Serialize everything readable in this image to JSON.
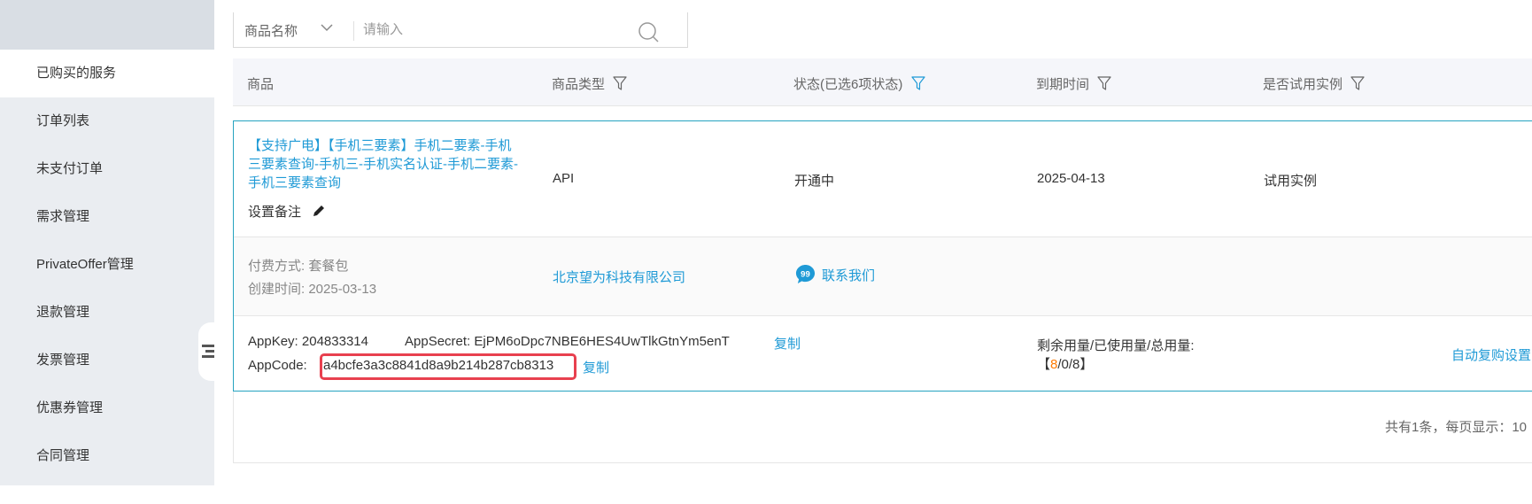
{
  "sidebar": {
    "items": [
      {
        "label": "已购买的服务",
        "active": true
      },
      {
        "label": "订单列表"
      },
      {
        "label": "未支付订单"
      },
      {
        "label": "需求管理"
      },
      {
        "label": "PrivateOffer管理"
      },
      {
        "label": "退款管理"
      },
      {
        "label": "发票管理"
      },
      {
        "label": "优惠券管理"
      },
      {
        "label": "合同管理"
      }
    ]
  },
  "search": {
    "field_selected": "商品名称",
    "placeholder": "请输入"
  },
  "table": {
    "headers": {
      "product": "商品",
      "type": "商品类型",
      "status": "状态(已选6项状态)",
      "expiry": "到期时间",
      "trial": "是否试用实例"
    }
  },
  "order": {
    "product_name": "【支持广电】【手机三要素】手机二要素-手机三要素查询-手机三-手机实名认证-手机二要素-手机三要素查询",
    "set_note": "设置备注",
    "type": "API",
    "status": "开通中",
    "expiry": "2025-04-13",
    "trial": "试用实例",
    "pay_method_label": "付费方式:",
    "pay_method": "套餐包",
    "created_label": "创建时间:",
    "created": "2025-03-13",
    "vendor": "北京望为科技有限公司",
    "contact": "联系我们",
    "appkey_label": "AppKey:",
    "appkey": "204833314",
    "appsecret_label": "AppSecret:",
    "appsecret": "EjPM6oDpc7NBE6HES4UwTlkGtnYm5enT",
    "copy": "复制",
    "appcode_label": "AppCode:",
    "appcode": "a4bcfe3a3c8841d8a9b214b287cb8313",
    "usage_label": "剩余用量/已使用量/总用量:",
    "usage_open": "【",
    "usage_remaining": "8",
    "usage_rest": "/0/8】",
    "auto_renew": "自动复购设置"
  },
  "pagination": {
    "summary": "共有1条，每页显示：10"
  },
  "colors": {
    "link": "#1f9ad6",
    "highlight": "#e8404f",
    "remaining": "#ff7a00",
    "card_border": "#26a3c0"
  },
  "icons": [
    "chevron-down-icon",
    "search-icon",
    "filter-icon",
    "pencil-icon",
    "quote-icon",
    "collapse-menu-icon"
  ]
}
